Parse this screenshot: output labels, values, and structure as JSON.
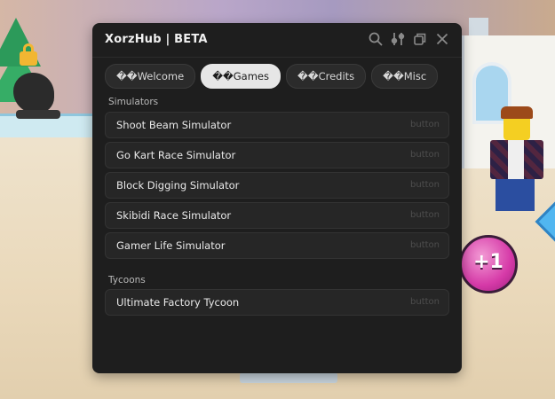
{
  "window": {
    "title": "XorzHub | BETA"
  },
  "titlebar_icons": [
    {
      "name": "search-icon"
    },
    {
      "name": "settings-sliders-icon"
    },
    {
      "name": "restore-window-icon"
    },
    {
      "name": "close-icon"
    }
  ],
  "tabs": [
    {
      "label": "��Welcome",
      "active": false
    },
    {
      "label": "��Games",
      "active": true
    },
    {
      "label": "��Credits",
      "active": false
    },
    {
      "label": "��Misc",
      "active": false
    }
  ],
  "sections": {
    "simulators": {
      "label": "Simulators",
      "items": [
        {
          "label": "Shoot Beam Simulator",
          "hint": "button"
        },
        {
          "label": "Go Kart Race Simulator",
          "hint": "button"
        },
        {
          "label": "Block Digging Simulator",
          "hint": "button"
        },
        {
          "label": "Skibidi Race Simulator",
          "hint": "button"
        },
        {
          "label": "Gamer Life Simulator",
          "hint": "button"
        }
      ]
    },
    "tycoons": {
      "label": "Tycoons",
      "items": [
        {
          "label": "Ultimate Factory Tycoon",
          "hint": "button"
        }
      ]
    }
  },
  "game_overlay": {
    "bubble_text": "+1"
  },
  "colors": {
    "window_bg": "#1e1e1e",
    "row_bg": "#262626",
    "active_tab_bg": "#e6e6e6",
    "bubble": "#d63aa8"
  }
}
